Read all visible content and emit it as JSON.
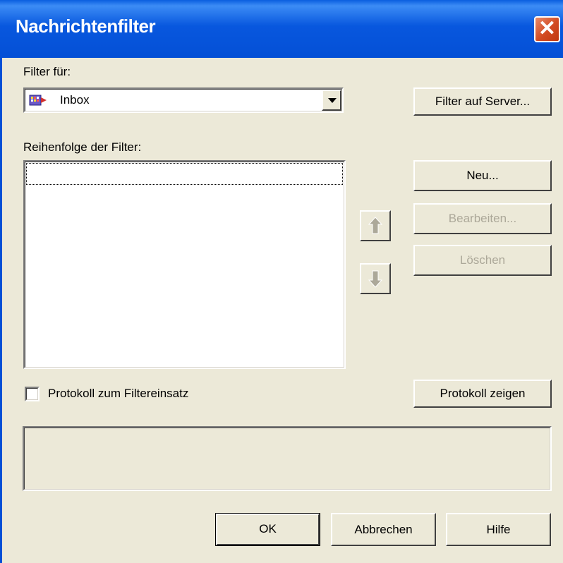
{
  "window": {
    "title": "Nachrichtenfilter",
    "close_icon": "close-icon"
  },
  "filter_for": {
    "label": "Filter für:",
    "selected": "Inbox",
    "icon": "inbox-icon"
  },
  "buttons": {
    "filter_on_server": "Filter auf Server...",
    "new": "Neu...",
    "edit": "Bearbeiten...",
    "delete": "Löschen",
    "show_log": "Protokoll zeigen",
    "ok": "OK",
    "cancel": "Abbrechen",
    "help": "Hilfe"
  },
  "filter_order": {
    "label": "Reihenfolge der Filter:",
    "items": []
  },
  "log_checkbox": {
    "label": "Protokoll zum Filtereinsatz",
    "checked": false
  },
  "colors": {
    "title_bar": "#0450d6",
    "dialog_bg": "#ece9d8",
    "disabled_text": "#aca899"
  }
}
